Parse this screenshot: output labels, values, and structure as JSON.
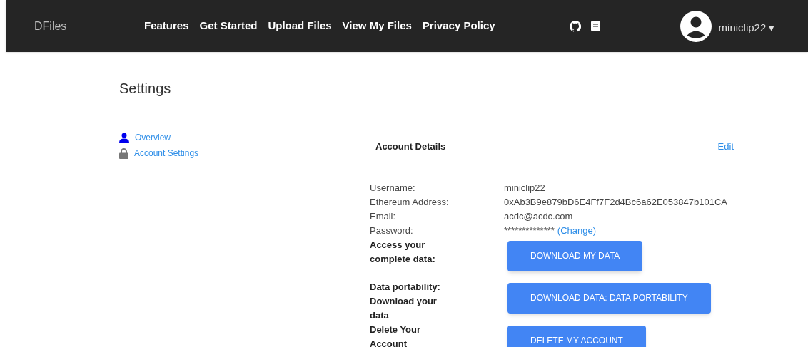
{
  "navbar": {
    "brand": "DFiles",
    "links": [
      "Features",
      "Get Started",
      "Upload Files",
      "View My Files",
      "Privacy Policy"
    ],
    "user": {
      "name": "miniclip22",
      "caret": "▾"
    }
  },
  "page_title": "Settings",
  "sidebar": {
    "items": [
      {
        "label": "Overview",
        "kind": "person"
      },
      {
        "label": "Account Settings",
        "kind": "lock"
      }
    ]
  },
  "account_details": {
    "title": "Account Details",
    "edit": "Edit",
    "fields": [
      {
        "label": "Username:",
        "value": "miniclip22"
      },
      {
        "label": "Ethereum Address:",
        "value": "0xAb3B9e879bD6E4Ff7F2d4Bc6a62E053847b101CA"
      },
      {
        "label": "Email:",
        "value": "acdc@acdc.com"
      },
      {
        "label": "Password:",
        "value": "**************",
        "link": "(Change)"
      }
    ],
    "actions": [
      {
        "label": "Access your complete data:",
        "button": "DOWNLOAD MY DATA"
      },
      {
        "label": "Data portability: Download your data",
        "button": "DOWNLOAD DATA: DATA PORTABILITY"
      },
      {
        "label": "Delete Your Account",
        "button": "DELETE MY ACCOUNT"
      }
    ]
  }
}
